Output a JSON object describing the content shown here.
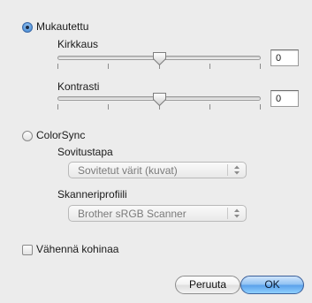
{
  "custom": {
    "label": "Mukautettu",
    "selected": true,
    "brightness": {
      "label": "Kirkkaus",
      "value": "0"
    },
    "contrast": {
      "label": "Kontrasti",
      "value": "0"
    }
  },
  "colorsync": {
    "label": "ColorSync",
    "selected": false,
    "matching": {
      "label": "Sovitustapa",
      "selected": "Sovitetut värit (kuvat)"
    },
    "scanner_profile": {
      "label": "Skanneriprofiili",
      "selected": "Brother sRGB Scanner"
    }
  },
  "noise_reduction": {
    "label": "Vähennä kohinaa",
    "checked": false
  },
  "buttons": {
    "cancel": "Peruuta",
    "ok": "OK"
  },
  "icons": {
    "slider_thumb": "triangle-down-thumb-icon",
    "popup_arrows": "up-down-arrows-icon"
  }
}
